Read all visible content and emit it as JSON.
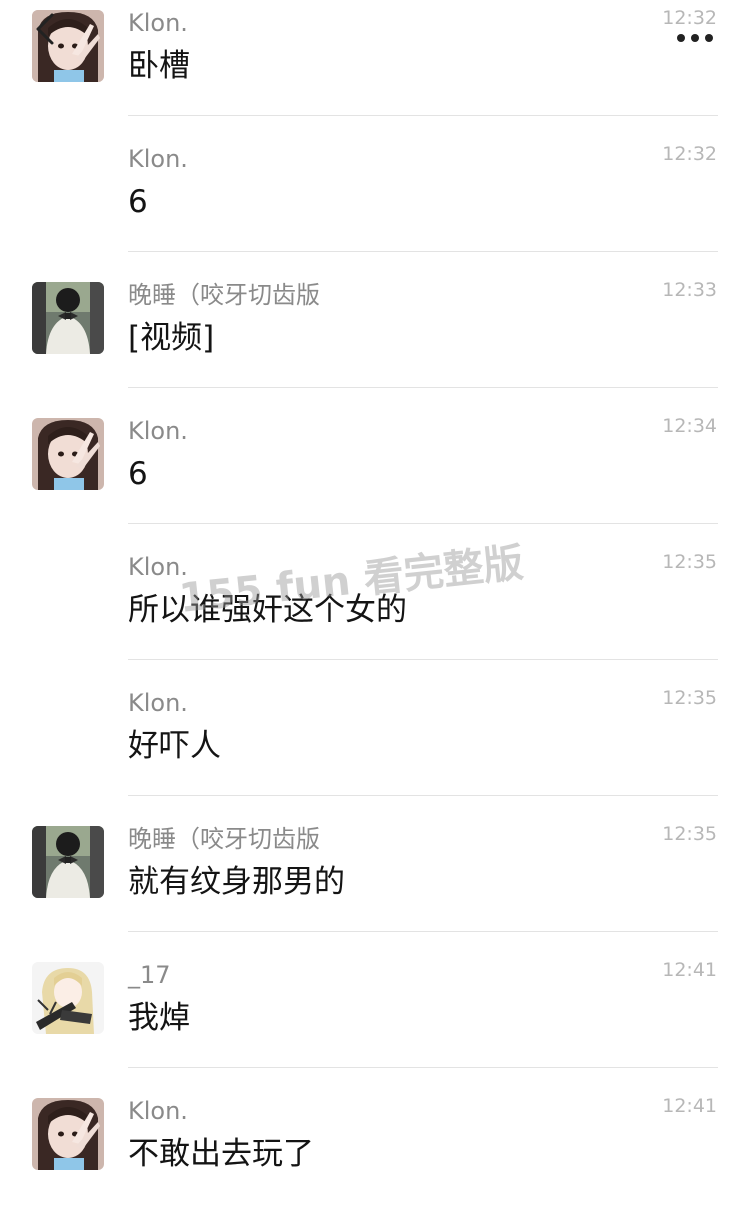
{
  "header": {
    "back_icon": "chevron-left-icon",
    "more_icon": "more-dots-icon"
  },
  "messages": [
    {
      "sender": "Klon.",
      "time": "12:32",
      "content": "卧槽",
      "avatar": "girl-avatar"
    },
    {
      "sender": "Klon.",
      "time": "12:32",
      "content": "6",
      "avatar": ""
    },
    {
      "sender": "晚睡（咬牙切齿版",
      "time": "12:33",
      "content": "[视频]",
      "avatar": "car-bow-avatar"
    },
    {
      "sender": "Klon.",
      "time": "12:34",
      "content": "6",
      "avatar": "girl-avatar"
    },
    {
      "sender": "Klon.",
      "time": "12:35",
      "content": "所以谁强奸这个女的",
      "avatar": ""
    },
    {
      "sender": "Klon.",
      "time": "12:35",
      "content": "好吓人",
      "avatar": ""
    },
    {
      "sender": "晚睡（咬牙切齿版",
      "time": "12:35",
      "content": "就有纹身那男的",
      "avatar": "car-bow-avatar"
    },
    {
      "sender": "_17",
      "time": "12:41",
      "content": "我焯",
      "avatar": "anime-guitar-avatar"
    },
    {
      "sender": "Klon.",
      "time": "12:41",
      "content": "不敢出去玩了",
      "avatar": "girl-avatar"
    }
  ],
  "watermark": "155 fun 看完整版"
}
